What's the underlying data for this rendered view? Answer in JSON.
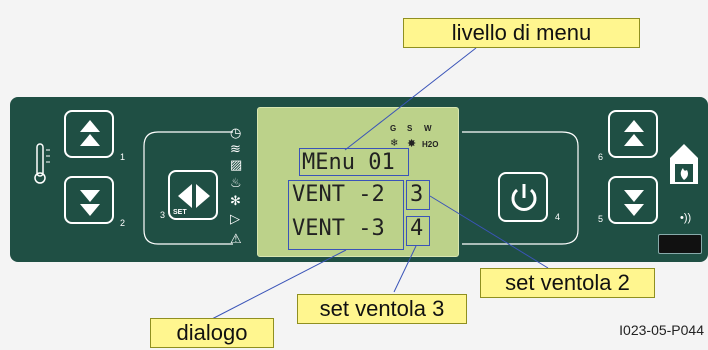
{
  "display": {
    "line1": "MEnu 01",
    "line2_label": "VENT -2",
    "line2_value": "3",
    "line3_label": "VENT -3",
    "line3_value": "4",
    "indicators": [
      "G",
      "S",
      "W"
    ],
    "h2o": "H2O"
  },
  "buttons": {
    "left_up_num": "1",
    "left_down_num": "2",
    "set_num": "3",
    "set_label": "SET",
    "power_num": "4",
    "right_down_num": "5",
    "right_up_num": "6"
  },
  "annotations": {
    "menu_level": "livello di menu",
    "fan2_set": "set ventola 2",
    "fan3_set": "set ventola 3",
    "dialog": "dialogo"
  },
  "document_code": "I023-05-P044",
  "colors": {
    "panel": "#1f4f44",
    "lcd": "#bcd28a",
    "callout": "#fff68f",
    "highlight_box": "#3a54b8"
  },
  "icons": [
    "thermometer-icon",
    "clock-icon",
    "heater-icon",
    "fan-icon",
    "play-icon",
    "warning-icon",
    "fireplace-icon",
    "wireless-icon",
    "power-icon"
  ]
}
